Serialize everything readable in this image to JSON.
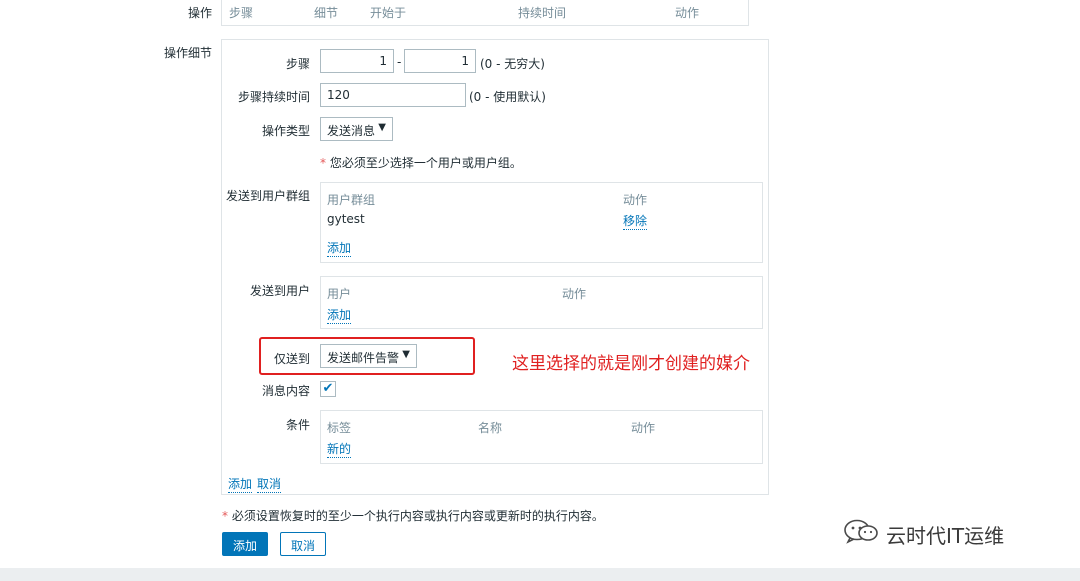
{
  "top_operations": {
    "label": "操作",
    "columns": [
      "步骤",
      "细节",
      "开始于",
      "持续时间",
      "动作"
    ]
  },
  "details": {
    "label": "操作细节",
    "steps": {
      "label": "步骤",
      "from": "1",
      "separator": "-",
      "to": "1",
      "hint": "(0 - 无穷大)"
    },
    "step_duration": {
      "label": "步骤持续时间",
      "value": "120",
      "hint": "(0 - 使用默认)"
    },
    "operation_type": {
      "label": "操作类型",
      "value": "发送消息"
    },
    "notice": "您必须至少选择一个用户或用户组。",
    "user_groups": {
      "label": "发送到用户群组",
      "col_group": "用户群组",
      "col_action": "动作",
      "rows": [
        {
          "name": "gytest",
          "action": "移除"
        }
      ],
      "add": "添加"
    },
    "users": {
      "label": "发送到用户",
      "col_user": "用户",
      "col_action": "动作",
      "add": "添加"
    },
    "send_only_to": {
      "label": "仅送到",
      "value": "发送邮件告警"
    },
    "message_content": {
      "label": "消息内容",
      "checked": "✔"
    },
    "conditions": {
      "label": "条件",
      "col_tag": "标签",
      "col_name": "名称",
      "col_action": "动作",
      "new": "新的"
    },
    "footer": {
      "add": "添加",
      "cancel": "取消"
    }
  },
  "bottom_notice": "必须设置恢复时的至少一个执行内容或执行内容或更新时的执行内容。",
  "buttons": {
    "add": "添加",
    "cancel": "取消"
  },
  "annotation": "这里选择的就是刚才创建的媒介",
  "watermark": "云时代IT运维",
  "required_marker": "*",
  "dropdown_arrow": "▼",
  "colors": {
    "accent": "#0275b8",
    "required": "#e45959",
    "annotation": "#e02020"
  }
}
